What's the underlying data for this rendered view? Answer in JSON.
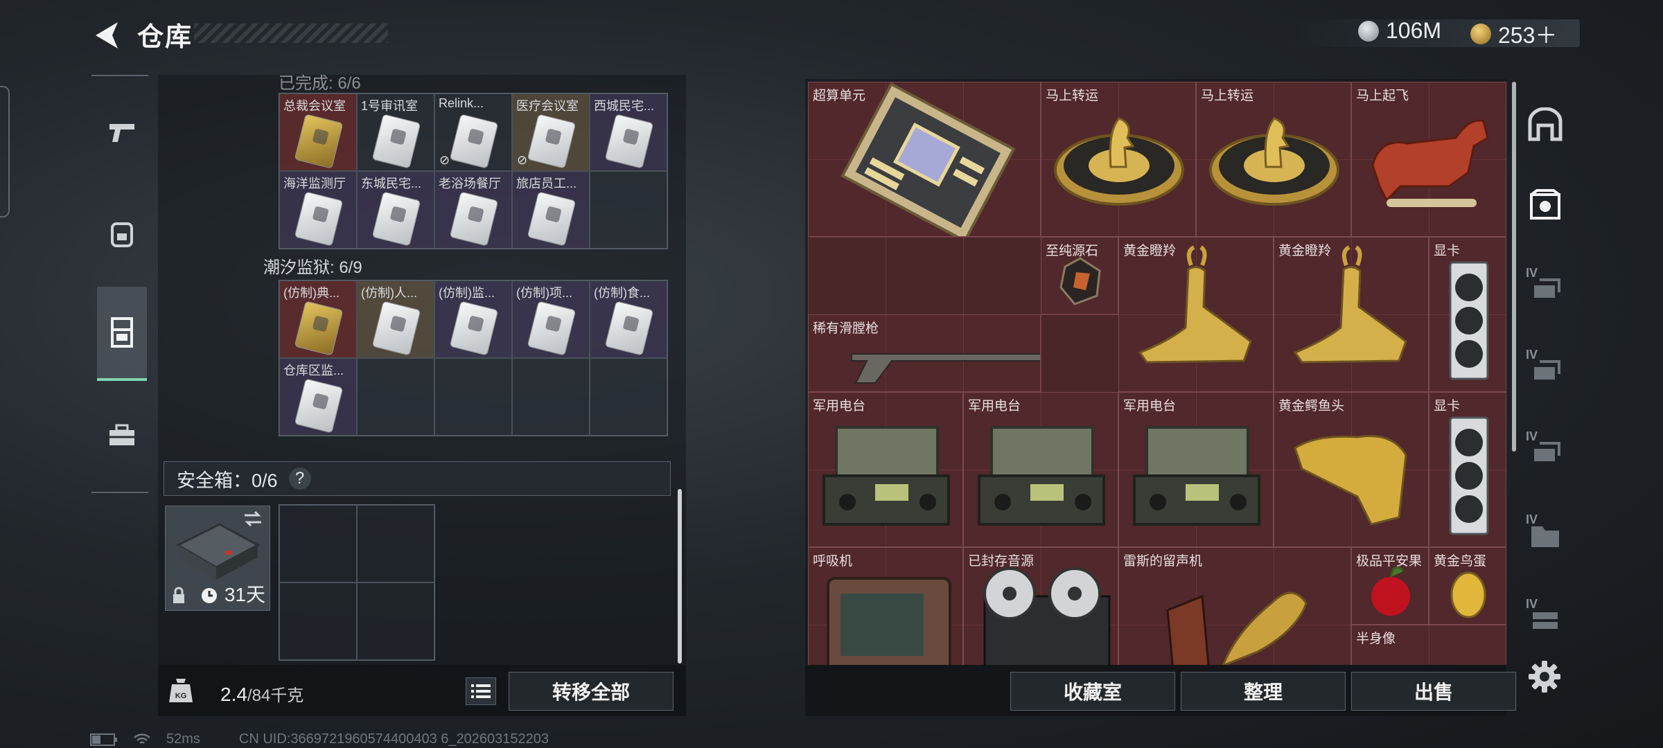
{
  "header": {
    "title": "仓库",
    "currency_1": "106M",
    "currency_2": "253＋"
  },
  "left_nav": [
    "weapon-tab",
    "backpack-tab",
    "storage-tab",
    "toolbox-tab"
  ],
  "storage": {
    "section_1_label": "已完成: 6/6",
    "section_1_items": [
      {
        "label": "总裁会议室",
        "style": "red",
        "card": "gold",
        "locked": false
      },
      {
        "label": "1号审讯室",
        "style": "plain",
        "card": "white",
        "locked": false
      },
      {
        "label": "Relink...",
        "style": "plain",
        "card": "white",
        "locked": true
      },
      {
        "label": "医疗会议室",
        "style": "gold",
        "card": "white",
        "locked": true
      },
      {
        "label": "西城民宅...",
        "style": "purple",
        "card": "white",
        "locked": false
      },
      {
        "label": "海洋监测厅",
        "style": "purple",
        "card": "white",
        "locked": false
      },
      {
        "label": "东城民宅...",
        "style": "purple",
        "card": "white",
        "locked": false
      },
      {
        "label": "老浴场餐厅",
        "style": "purple",
        "card": "white",
        "locked": false
      },
      {
        "label": "旅店员工...",
        "style": "purple",
        "card": "white",
        "locked": false
      }
    ],
    "section_2_label": "潮汐监狱: 6/9",
    "section_2_items": [
      {
        "label": "(仿制)典...",
        "style": "red",
        "card": "gold"
      },
      {
        "label": "(仿制)人...",
        "style": "gold",
        "card": "white"
      },
      {
        "label": "(仿制)监...",
        "style": "purple",
        "card": "white"
      },
      {
        "label": "(仿制)项...",
        "style": "purple",
        "card": "white"
      },
      {
        "label": "(仿制)食...",
        "style": "purple",
        "card": "white"
      },
      {
        "label": "仓库区监...",
        "style": "purple",
        "card": "white"
      }
    ],
    "safe_box_label": "安全箱：0/6",
    "safe_help": "?",
    "case_time": "31天",
    "weight_current": "2.4",
    "weight_max": "/84千克",
    "transfer_all": "转移全部"
  },
  "status": {
    "ping": "52ms",
    "uid": "CN UID:3669721960574400403 6_202603152203"
  },
  "collection": {
    "items": [
      {
        "label": "超算单元",
        "kind": "board"
      },
      {
        "label": "马上转运",
        "kind": "disc"
      },
      {
        "label": "马上转运",
        "kind": "disc"
      },
      {
        "label": "马上起飞",
        "kind": "horse"
      },
      {
        "label": "至纯源石",
        "kind": "gem"
      },
      {
        "label": "黄金瞪羚",
        "kind": "gazelle"
      },
      {
        "label": "黄金瞪羚",
        "kind": "gazelle"
      },
      {
        "label": "显卡",
        "kind": "gpu"
      },
      {
        "label": "稀有滑膛枪",
        "kind": "musket"
      },
      {
        "label": "军用电台",
        "kind": "radio"
      },
      {
        "label": "军用电台",
        "kind": "radio"
      },
      {
        "label": "军用电台",
        "kind": "radio"
      },
      {
        "label": "黄金鳄鱼头",
        "kind": "croc"
      },
      {
        "label": "显卡",
        "kind": "gpu"
      },
      {
        "label": "呼吸机",
        "kind": "ventilator"
      },
      {
        "label": "已封存音源",
        "kind": "reel"
      },
      {
        "label": "雷斯的留声机",
        "kind": "gramophone"
      },
      {
        "label": "极品平安果",
        "kind": "apple"
      },
      {
        "label": "黄金鸟蛋",
        "kind": "egg"
      },
      {
        "label": "半身像",
        "kind": "bust"
      }
    ],
    "buttons": {
      "vault": "收藏室",
      "sort": "整理",
      "sell": "出售"
    }
  },
  "right_tabs": {
    "roman_labels": [
      "IV",
      "IV",
      "IV",
      "IV",
      "IV"
    ]
  },
  "colors": {
    "accent_green": "#7fd6b0",
    "collection_bg": "#4a2629",
    "gold": "#d4b04a"
  }
}
